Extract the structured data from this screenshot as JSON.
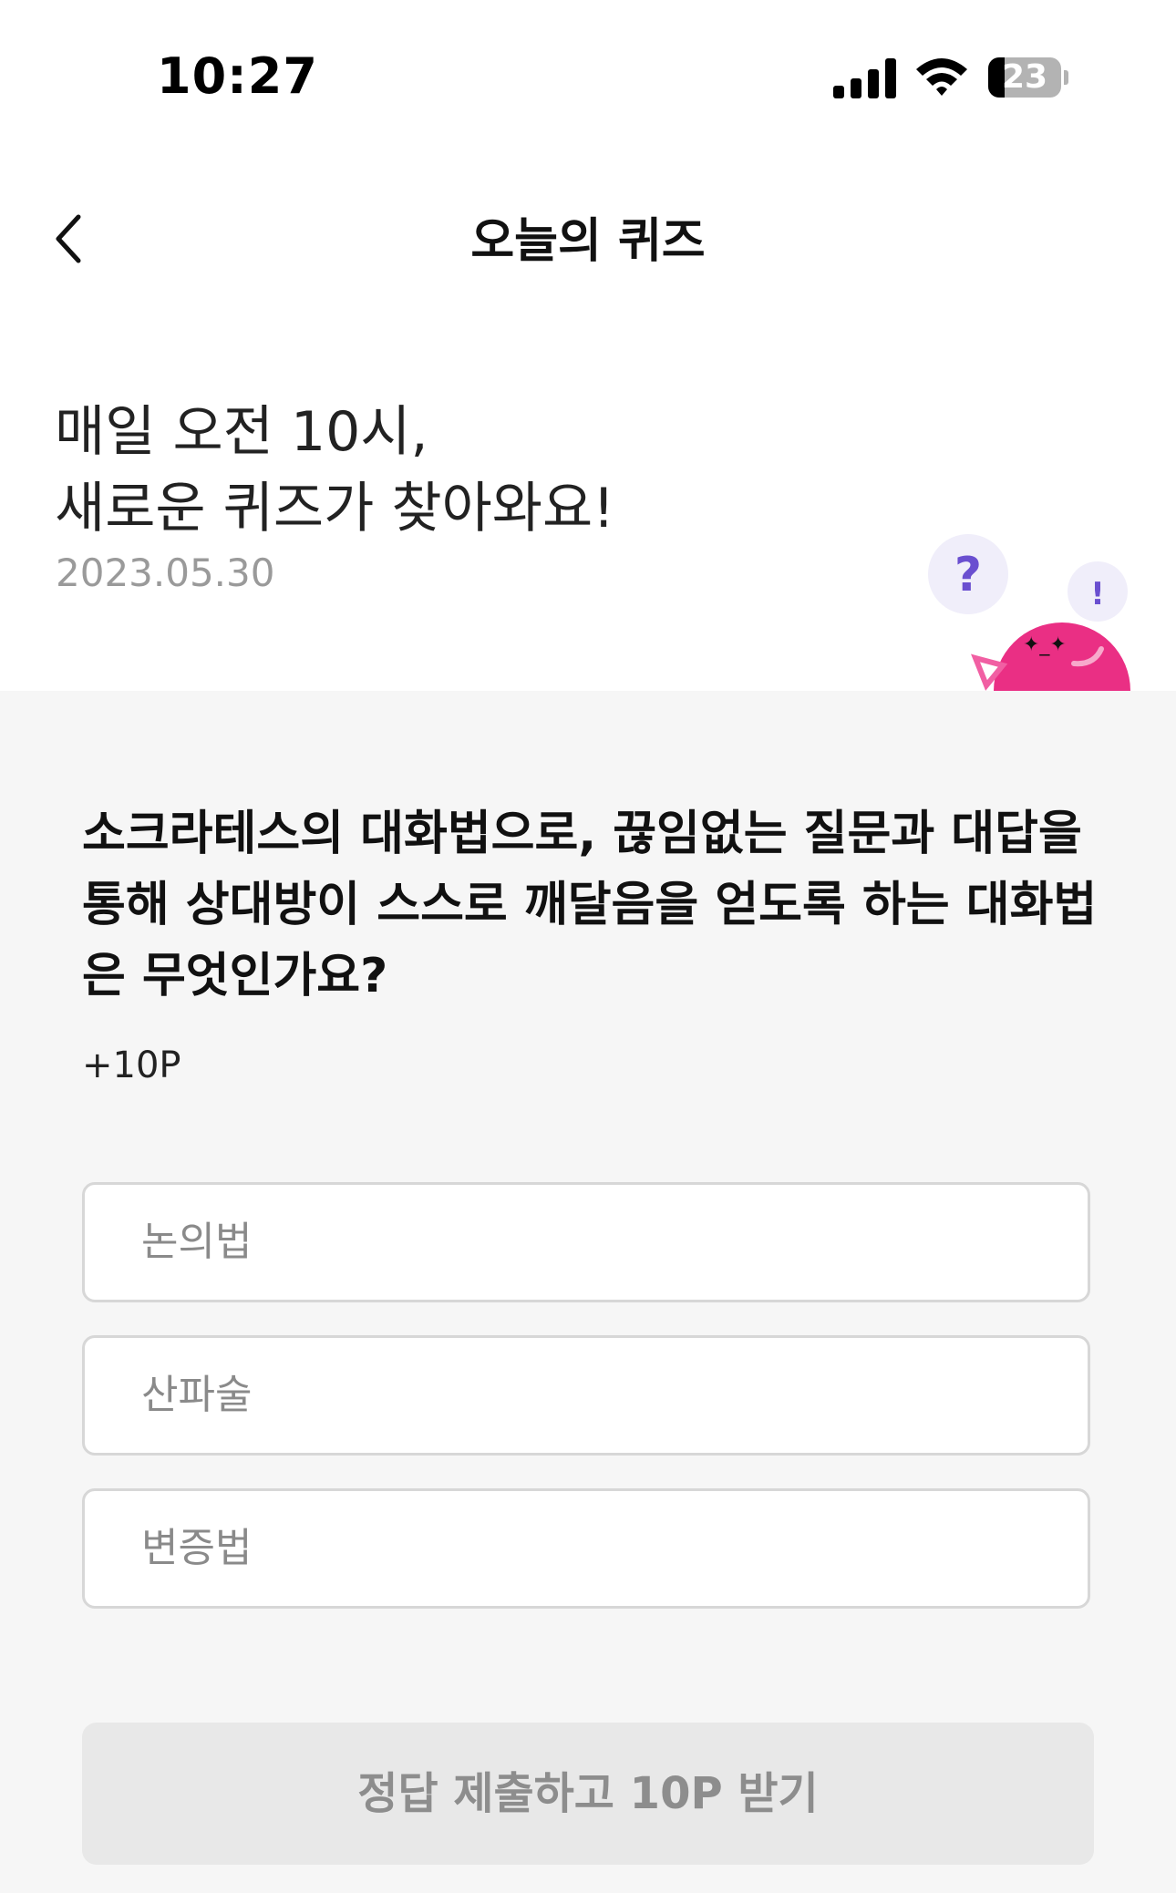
{
  "status_bar": {
    "time": "10:27",
    "battery": "23",
    "battery_level": 0.23
  },
  "header": {
    "title": "오늘의 퀴즈",
    "back_icon": "chevron-left-icon"
  },
  "hero": {
    "line1": "매일 오전 10시,",
    "line2": "새로운 퀴즈가 찾아와요!",
    "date": "2023.05.30",
    "mascot_bubble_left": "?",
    "mascot_bubble_right": "!"
  },
  "quiz": {
    "question": "소크라테스의 대화법으로, 끊임없는 질문과 대답을 통해 상대방이 스스로 깨달음을 얻도록 하는 대화법은 무엇인가요?",
    "points": "+10P",
    "options": [
      {
        "label": "논의법"
      },
      {
        "label": "산파술"
      },
      {
        "label": "변증법"
      }
    ],
    "submit_label": "정답 제출하고 10P 받기"
  },
  "colors": {
    "panel_bg": "#f6f6f6",
    "mascot": "#ea2f84",
    "bubble": "#f0eefa",
    "bubble_text": "#6a4fd0",
    "submit_bg": "#e8e8e8",
    "submit_text": "#8d8d8d"
  }
}
